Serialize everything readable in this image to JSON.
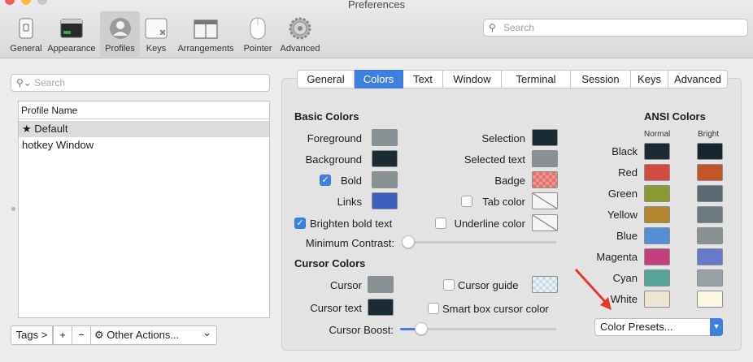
{
  "window": {
    "title": "Preferences"
  },
  "toolbar": {
    "items": [
      {
        "label": "General",
        "icon": "general-icon"
      },
      {
        "label": "Appearance",
        "icon": "appearance-icon"
      },
      {
        "label": "Profiles",
        "icon": "profiles-icon",
        "selected": true
      },
      {
        "label": "Keys",
        "icon": "keys-icon"
      },
      {
        "label": "Arrangements",
        "icon": "arrangements-icon"
      },
      {
        "label": "Pointer",
        "icon": "pointer-icon"
      },
      {
        "label": "Advanced",
        "icon": "advanced-icon"
      }
    ],
    "search_placeholder": "Search"
  },
  "profiles": {
    "search_placeholder": "Search",
    "column_header": "Profile Name",
    "rows": [
      {
        "name": "Default",
        "star": "★",
        "selected": true
      },
      {
        "name": "hotkey Window"
      }
    ],
    "tags_label": "Tags >",
    "add_label": "+",
    "remove_label": "−",
    "other_actions_label": "Other Actions...",
    "other_actions_chevron": "⌄"
  },
  "tabs": [
    "General",
    "Colors",
    "Text",
    "Window",
    "Terminal",
    "Session",
    "Keys",
    "Advanced"
  ],
  "selected_tab": "Colors",
  "basic_colors": {
    "heading": "Basic Colors",
    "foreground": {
      "label": "Foreground",
      "color": "#8a9194"
    },
    "background": {
      "label": "Background",
      "color": "#1b2b34"
    },
    "bold": {
      "label": "Bold",
      "checked": true,
      "color": "#8a9194"
    },
    "links": {
      "label": "Links",
      "color": "#3f5fbf"
    },
    "selection": {
      "label": "Selection",
      "color": "#1b2b34"
    },
    "selected_text": {
      "label": "Selected text",
      "color": "#8a9194"
    },
    "badge": {
      "label": "Badge",
      "color": "#e0736a"
    },
    "tab_color": {
      "label": "Tab color",
      "checked": false
    },
    "brighten_bold": {
      "label": "Brighten bold text",
      "checked": true
    },
    "underline_color": {
      "label": "Underline color",
      "checked": false
    },
    "min_contrast": {
      "label": "Minimum Contrast:",
      "value": 0
    }
  },
  "cursor_colors": {
    "heading": "Cursor Colors",
    "cursor": {
      "label": "Cursor",
      "color": "#8a9194"
    },
    "cursor_text": {
      "label": "Cursor text",
      "color": "#1b2b34"
    },
    "cursor_guide": {
      "label": "Cursor guide",
      "checked": false
    },
    "smart_box": {
      "label": "Smart box cursor color",
      "checked": false
    },
    "cursor_boost": {
      "label": "Cursor Boost:",
      "value": 0.1
    }
  },
  "ansi": {
    "heading": "ANSI Colors",
    "normal_label": "Normal",
    "bright_label": "Bright",
    "rows": [
      {
        "label": "Black",
        "normal": "#1b2b34",
        "bright": "#16262e"
      },
      {
        "label": "Red",
        "normal": "#d24a44",
        "bright": "#c2552a"
      },
      {
        "label": "Green",
        "normal": "#8c9a36",
        "bright": "#5a6a70"
      },
      {
        "label": "Yellow",
        "normal": "#b3862e",
        "bright": "#6c7a80"
      },
      {
        "label": "Blue",
        "normal": "#548fd6",
        "bright": "#8a9194"
      },
      {
        "label": "Magenta",
        "normal": "#c2407f",
        "bright": "#6a78c8"
      },
      {
        "label": "Cyan",
        "normal": "#58a39a",
        "bright": "#9aa1a4"
      },
      {
        "label": "White",
        "normal": "#ede6d6",
        "bright": "#fbf6e6"
      }
    ]
  },
  "color_presets_label": "Color Presets...",
  "accent": "#3f7fe0"
}
